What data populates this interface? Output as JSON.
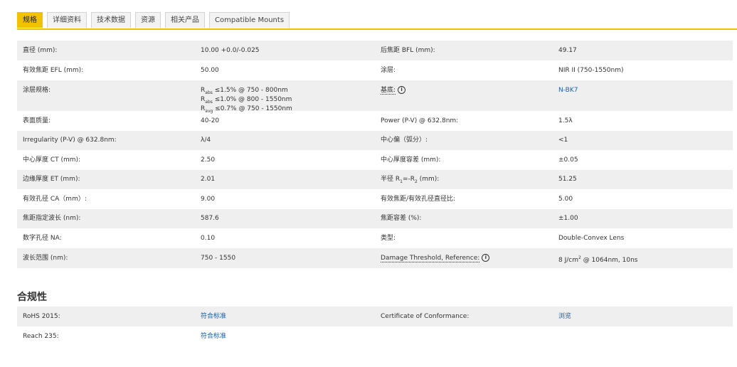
{
  "tabs": [
    "规格",
    "详细资料",
    "技术数据",
    "资源",
    "相关产品",
    "Compatible Mounts"
  ],
  "specs": {
    "r1": {
      "l1": "直径 (mm):",
      "v1": "10.00 +0.0/-0.025",
      "l2": "后焦距 BFL (mm):",
      "v2": "49.17"
    },
    "r2": {
      "l1": "有效焦距 EFL (mm):",
      "v1": "50.00",
      "l2": "涂层:",
      "v2": "NIR II (750-1550nm)"
    },
    "r3": {
      "l1": "涂层规格:",
      "v1a_pre": "R",
      "v1a_sub": "abs",
      "v1a_post": " ≤1.5% @ 750 - 800nm",
      "v1b_pre": "R",
      "v1b_sub": "abs",
      "v1b_post": " ≤1.0% @ 800 - 1550nm",
      "v1c_pre": "R",
      "v1c_sub": "avg",
      "v1c_post": " ≤0.7% @ 750 - 1550nm",
      "l2": "基底:",
      "v2": "N-BK7"
    },
    "r4": {
      "l1": "表面质量:",
      "v1": "40-20",
      "l2": "Power (P-V) @ 632.8nm:",
      "v2": "1.5λ"
    },
    "r5": {
      "l1": "Irregularity (P-V) @ 632.8nm:",
      "v1": "λ/4",
      "l2": "中心偏（弧分）:",
      "v2": "<1"
    },
    "r6": {
      "l1": "中心厚度 CT (mm):",
      "v1": "2.50",
      "l2": "中心厚度容差 (mm):",
      "v2": "±0.05"
    },
    "r7": {
      "l1": "边缘厚度 ET (mm):",
      "v1": "2.01",
      "l2a": "半径 R",
      "l2sub1": "1",
      "l2b": "=-R",
      "l2sub2": "2",
      "l2c": " (mm):",
      "v2": "51.25"
    },
    "r8": {
      "l1": "有效孔径 CA（mm）:",
      "v1": "9.00",
      "l2": "有效焦距/有效孔径直径比:",
      "v2": "5.00"
    },
    "r9": {
      "l1": "焦距指定波长 (nm):",
      "v1": "587.6",
      "l2": "焦距容差 (%):",
      "v2": "±1.00"
    },
    "r10": {
      "l1": "数字孔径 NA:",
      "v1": "0.10",
      "l2": "类型:",
      "v2": "Double-Convex Lens"
    },
    "r11": {
      "l1": "波长范围 (nm):",
      "v1": "750 - 1550",
      "l2": "Damage Threshold, Reference:",
      "v2a": "8 J/cm",
      "v2sup": "2",
      "v2b": " @ 1064nm, 10ns"
    }
  },
  "info_glyph": "i",
  "compliance": {
    "title": "合规性",
    "r1": {
      "l1": "RoHS 2015:",
      "v1": "符合标准",
      "l2": "Certificate of Conformance:",
      "v2": "浏览"
    },
    "r2": {
      "l1": "Reach 235:",
      "v1": "符合标准"
    }
  }
}
